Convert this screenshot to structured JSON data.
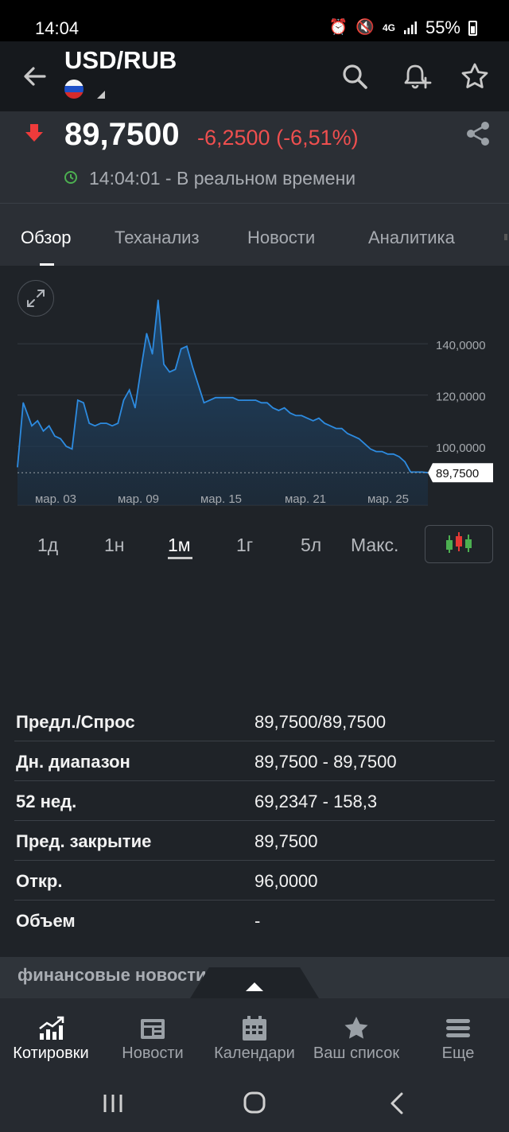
{
  "status_bar": {
    "time": "14:04",
    "network": "4G",
    "battery": "55%"
  },
  "header": {
    "title": "USD/RUB"
  },
  "quote": {
    "price": "89,7500",
    "change": "-6,2500 (-6,51%)",
    "time_label": "14:04:01 - В реальном времени",
    "direction": "down",
    "down_color": "#ef4f4f"
  },
  "tabs": [
    {
      "label": "Обзор",
      "active": true
    },
    {
      "label": "Теханализ",
      "active": false
    },
    {
      "label": "Новости",
      "active": false
    },
    {
      "label": "Аналитика",
      "active": false
    }
  ],
  "chart_data": {
    "type": "area",
    "x_tick_labels": [
      "мар. 03",
      "мар. 09",
      "мар. 15",
      "мар. 21",
      "мар. 25"
    ],
    "y_tick_labels": [
      "140,0000",
      "120,0000",
      "100,0000"
    ],
    "y_ticks": [
      140,
      120,
      100
    ],
    "ylim": [
      83,
      158
    ],
    "x_range": [
      0,
      143
    ],
    "last_value_label": "89,7500",
    "last_value": 89.75,
    "line_color": "#2d8be0",
    "grid": true,
    "points": [
      [
        0,
        92
      ],
      [
        2,
        117
      ],
      [
        5,
        108
      ],
      [
        7,
        110
      ],
      [
        9,
        106
      ],
      [
        11,
        108
      ],
      [
        13,
        104
      ],
      [
        15,
        103
      ],
      [
        17,
        100
      ],
      [
        19,
        99
      ],
      [
        21,
        118
      ],
      [
        23,
        117
      ],
      [
        25,
        109
      ],
      [
        27,
        108
      ],
      [
        29,
        109
      ],
      [
        31,
        109
      ],
      [
        33,
        108
      ],
      [
        35,
        109
      ],
      [
        37,
        118
      ],
      [
        39,
        122
      ],
      [
        41,
        115
      ],
      [
        43,
        130
      ],
      [
        45,
        144
      ],
      [
        47,
        136
      ],
      [
        49,
        157
      ],
      [
        51,
        132
      ],
      [
        53,
        129
      ],
      [
        55,
        130
      ],
      [
        57,
        138
      ],
      [
        59,
        139
      ],
      [
        61,
        131
      ],
      [
        63,
        124
      ],
      [
        65,
        117
      ],
      [
        67,
        118
      ],
      [
        69,
        119
      ],
      [
        71,
        119
      ],
      [
        73,
        119
      ],
      [
        75,
        119
      ],
      [
        77,
        118
      ],
      [
        79,
        118
      ],
      [
        81,
        118
      ],
      [
        83,
        118
      ],
      [
        85,
        117
      ],
      [
        87,
        117
      ],
      [
        89,
        115
      ],
      [
        91,
        114
      ],
      [
        93,
        115
      ],
      [
        95,
        113
      ],
      [
        97,
        112
      ],
      [
        99,
        112
      ],
      [
        101,
        111
      ],
      [
        103,
        110
      ],
      [
        105,
        111
      ],
      [
        107,
        109
      ],
      [
        109,
        108
      ],
      [
        111,
        107
      ],
      [
        113,
        107
      ],
      [
        115,
        105
      ],
      [
        117,
        104
      ],
      [
        119,
        103
      ],
      [
        121,
        101
      ],
      [
        123,
        99
      ],
      [
        125,
        98
      ],
      [
        127,
        98
      ],
      [
        129,
        97
      ],
      [
        131,
        97
      ],
      [
        133,
        96
      ],
      [
        135,
        94
      ],
      [
        137,
        90
      ],
      [
        139,
        90
      ],
      [
        141,
        90
      ],
      [
        143,
        89.75
      ]
    ]
  },
  "ranges": [
    {
      "label": "1д",
      "active": false
    },
    {
      "label": "1н",
      "active": false
    },
    {
      "label": "1м",
      "active": true
    },
    {
      "label": "1г",
      "active": false
    },
    {
      "label": "5л",
      "active": false
    },
    {
      "label": "Макс.",
      "active": false
    }
  ],
  "stats": [
    {
      "label": "Предл./Спрос",
      "value": "89,7500/89,7500"
    },
    {
      "label": "Дн. диапазон",
      "value": "89,7500 - 89,7500"
    },
    {
      "label": "52 нед.",
      "value": "69,2347 - 158,3"
    },
    {
      "label": "Пред. закрытие",
      "value": "89,7500"
    },
    {
      "label": "Откр.",
      "value": "96,0000"
    },
    {
      "label": "Объем",
      "value": "-"
    }
  ],
  "news": {
    "title": "финансовые новости"
  },
  "bottom_nav": [
    {
      "label": "Котировки",
      "icon": "quotes-chart-icon",
      "active": true
    },
    {
      "label": "Новости",
      "icon": "newspaper-icon",
      "active": false
    },
    {
      "label": "Календари",
      "icon": "calendar-icon",
      "active": false
    },
    {
      "label": "Ваш список",
      "icon": "star-icon",
      "active": false
    },
    {
      "label": "Еще",
      "icon": "menu-icon",
      "active": false
    }
  ]
}
